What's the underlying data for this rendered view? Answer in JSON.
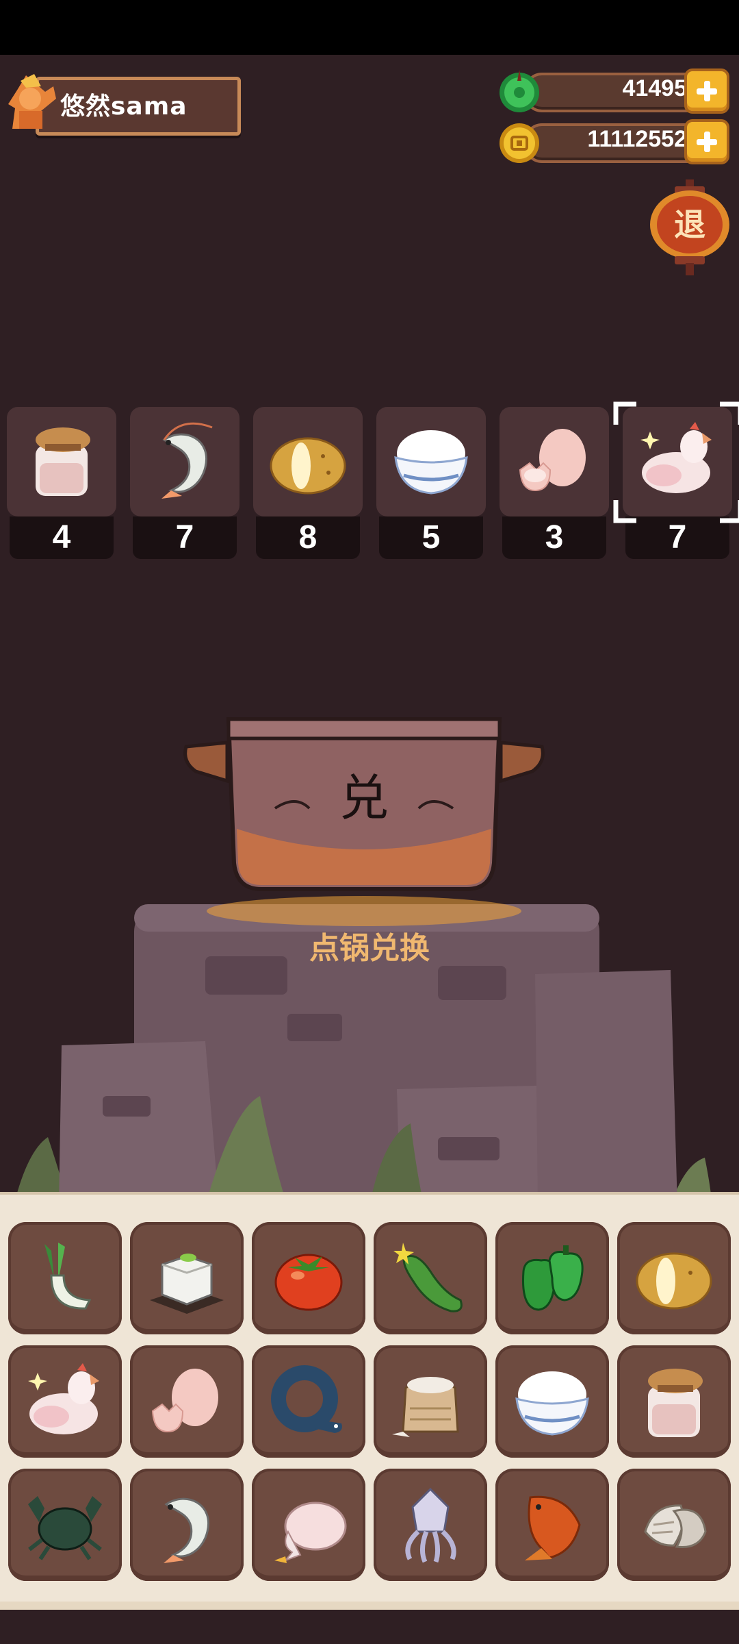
{
  "player": {
    "name": "悠然sama"
  },
  "currencies": [
    {
      "kind": "jade",
      "value": "41495",
      "icon": "jade-icon"
    },
    {
      "kind": "coin",
      "value": "11112552",
      "icon": "coin-icon"
    }
  ],
  "exit_button": {
    "label": "退"
  },
  "recipe": [
    {
      "item": "sugar-jar",
      "count": "4",
      "selected": false
    },
    {
      "item": "shrimp",
      "count": "7",
      "selected": false
    },
    {
      "item": "potato",
      "count": "8",
      "selected": false
    },
    {
      "item": "rice-bowl",
      "count": "5",
      "selected": false
    },
    {
      "item": "egg",
      "count": "3",
      "selected": false
    },
    {
      "item": "chicken",
      "count": "7",
      "selected": true
    }
  ],
  "pot": {
    "glyph": "兑",
    "caption": "点锅兑换"
  },
  "inventory": [
    [
      "leek",
      "tofu",
      "tomato",
      "cucumber",
      "green-pepper",
      "potato"
    ],
    [
      "chicken",
      "egg",
      "eel",
      "flour-sack",
      "rice-bowl",
      "sugar-jar"
    ],
    [
      "crab",
      "shrimp",
      "duck",
      "squid",
      "carp",
      "clam"
    ]
  ],
  "colors": {
    "background": "#2f1f23",
    "panel": "#efe5d6",
    "cell": "#6e4b40",
    "accent": "#f3b52b",
    "caption": "#f0b870"
  }
}
